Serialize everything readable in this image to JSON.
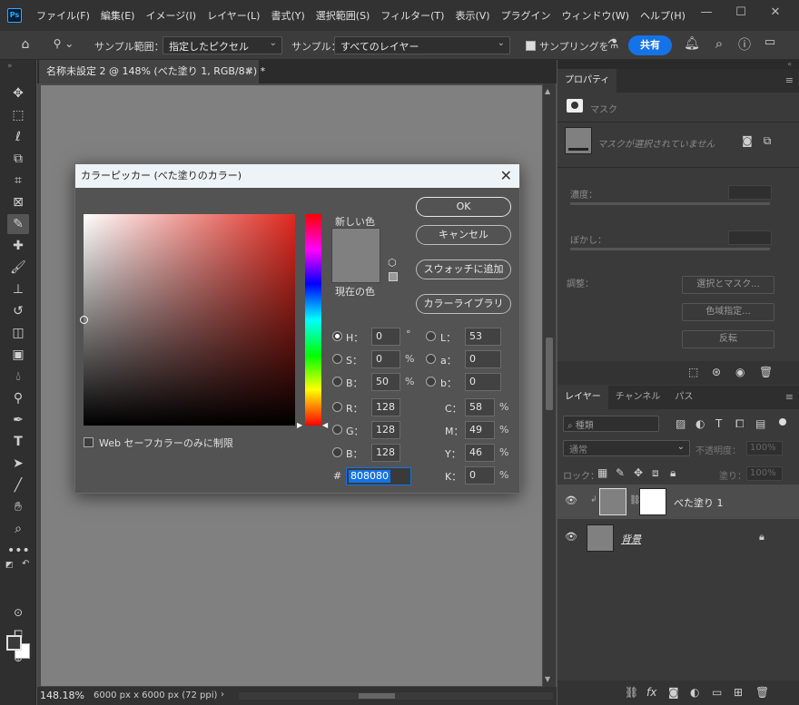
{
  "menubar": {
    "logo": "Ps",
    "items": [
      "ファイル(F)",
      "編集(E)",
      "イメージ(I)",
      "レイヤー(L)",
      "書式(Y)",
      "選択範囲(S)",
      "フィルター(T)",
      "表示(V)",
      "プラグイン",
      "ウィンドウ(W)",
      "ヘルプ(H)"
    ],
    "icons": [
      "minimize-icon",
      "maximize-icon",
      "close-icon"
    ]
  },
  "options": {
    "sample_size_label": "サンプル範囲：",
    "sample_size_value": "指定したピクセル",
    "sample_label": "サンプル：",
    "sample_value": "すべてのレイヤー",
    "sampling_ring_label": "サンプリングを",
    "sampling_ring_checked": true,
    "share_label": "共有",
    "icons": [
      "home-icon",
      "eyedropper-icon",
      "flask-icon",
      "bell-icon",
      "search-icon",
      "help-icon",
      "workspace-icon"
    ]
  },
  "document": {
    "tab_title": "名称未設定 2 @ 148% (べた塗り 1, RGB/8#) *",
    "zoom": "148.18%",
    "size_info": "6000 px x 6000 px (72 ppi)",
    "canvas_color": "#808080"
  },
  "tools": [
    "move-tool-icon",
    "marquee-tool-icon",
    "lasso-tool-icon",
    "object-select-icon",
    "crop-tool-icon",
    "frame-tool-icon",
    "eyedropper-tool-icon",
    "healing-brush-icon",
    "brush-tool-icon",
    "stamp-tool-icon",
    "history-brush-icon",
    "eraser-tool-icon",
    "gradient-tool-icon",
    "blur-tool-icon",
    "dodge-tool-icon",
    "pen-tool-icon",
    "type-tool-icon",
    "path-select-icon",
    "line-tool-icon",
    "hand-tool-icon",
    "zoom-tool-icon",
    "more-tools-icon"
  ],
  "properties": {
    "tab": "プロパティ",
    "section": "マスク",
    "no_mask": "マスクが選択されていません",
    "density": "濃度：",
    "feather": "ぼかし：",
    "adjust": "調整：",
    "select_mask_btn": "選択とマスク...",
    "color_range_btn": "色域指定...",
    "invert_btn": "反転"
  },
  "layers": {
    "tabs": [
      "レイヤー",
      "チャンネル",
      "パス"
    ],
    "filter": "種類",
    "blend_mode": "通常",
    "opacity_label": "不透明度：",
    "opacity_value": "100%",
    "lock_label": "ロック：",
    "fill_label": "塗り：",
    "fill_value": "100%",
    "items": [
      {
        "name": "べた塗り 1",
        "visible": true
      },
      {
        "name": "背景",
        "visible": true
      }
    ]
  },
  "dialog": {
    "title": "カラーピッカー (べた塗りのカラー)",
    "new_label": "新しい色",
    "current_label": "現在の色",
    "new_color": "#808080",
    "current_color": "#808080",
    "ok": "OK",
    "cancel": "キャンセル",
    "add_swatch": "スウォッチに追加",
    "color_libraries": "カラーライブラリ",
    "web_only": "Web セーフカラーのみに制限",
    "fields": {
      "H": {
        "label": "H：",
        "value": "0",
        "unit": "°"
      },
      "S": {
        "label": "S：",
        "value": "0",
        "unit": "%"
      },
      "B": {
        "label": "B：",
        "value": "50",
        "unit": "%"
      },
      "R": {
        "label": "R：",
        "value": "128"
      },
      "G": {
        "label": "G：",
        "value": "128"
      },
      "Bl": {
        "label": "B：",
        "value": "128"
      },
      "L": {
        "label": "L：",
        "value": "53"
      },
      "a": {
        "label": "a：",
        "value": "0"
      },
      "b": {
        "label": "b：",
        "value": "0"
      },
      "C": {
        "label": "C：",
        "value": "58",
        "unit": "%"
      },
      "M": {
        "label": "M：",
        "value": "49",
        "unit": "%"
      },
      "Y": {
        "label": "Y：",
        "value": "46",
        "unit": "%"
      },
      "K": {
        "label": "K：",
        "value": "0",
        "unit": "%"
      }
    },
    "hash": "#",
    "hex": "808080"
  }
}
